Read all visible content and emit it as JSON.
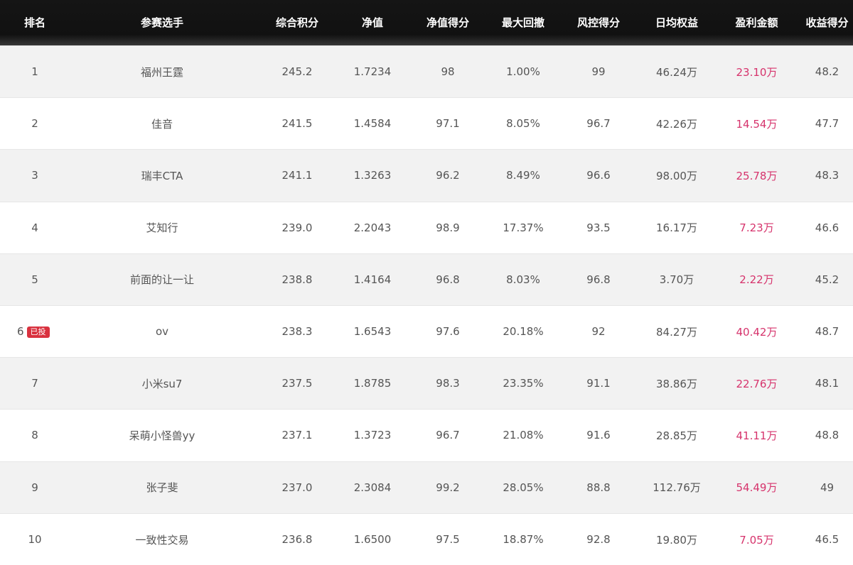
{
  "columns": [
    "排名",
    "参赛选手",
    "综合积分",
    "净值",
    "净值得分",
    "最大回撤",
    "风控得分",
    "日均权益",
    "盈利金额",
    "收益得分"
  ],
  "rows": [
    {
      "rank": "1",
      "name": "福州王霆",
      "score": "245.2",
      "nav": "1.7234",
      "nav_score": "98",
      "drawdown": "1.00%",
      "risk_score": "99",
      "equity": "46.24万",
      "profit": "23.10万",
      "return_score": "48.2",
      "badge": ""
    },
    {
      "rank": "2",
      "name": "佳音",
      "score": "241.5",
      "nav": "1.4584",
      "nav_score": "97.1",
      "drawdown": "8.05%",
      "risk_score": "96.7",
      "equity": "42.26万",
      "profit": "14.54万",
      "return_score": "47.7",
      "badge": ""
    },
    {
      "rank": "3",
      "name": "瑞丰CTA",
      "score": "241.1",
      "nav": "1.3263",
      "nav_score": "96.2",
      "drawdown": "8.49%",
      "risk_score": "96.6",
      "equity": "98.00万",
      "profit": "25.78万",
      "return_score": "48.3",
      "badge": ""
    },
    {
      "rank": "4",
      "name": "艾知行",
      "score": "239.0",
      "nav": "2.2043",
      "nav_score": "98.9",
      "drawdown": "17.37%",
      "risk_score": "93.5",
      "equity": "16.17万",
      "profit": "7.23万",
      "return_score": "46.6",
      "badge": ""
    },
    {
      "rank": "5",
      "name": "前面的让一让",
      "score": "238.8",
      "nav": "1.4164",
      "nav_score": "96.8",
      "drawdown": "8.03%",
      "risk_score": "96.8",
      "equity": "3.70万",
      "profit": "2.22万",
      "return_score": "45.2",
      "badge": ""
    },
    {
      "rank": "6",
      "name": "ov",
      "score": "238.3",
      "nav": "1.6543",
      "nav_score": "97.6",
      "drawdown": "20.18%",
      "risk_score": "92",
      "equity": "84.27万",
      "profit": "40.42万",
      "return_score": "48.7",
      "badge": "已投"
    },
    {
      "rank": "7",
      "name": "小米su7",
      "score": "237.5",
      "nav": "1.8785",
      "nav_score": "98.3",
      "drawdown": "23.35%",
      "risk_score": "91.1",
      "equity": "38.86万",
      "profit": "22.76万",
      "return_score": "48.1",
      "badge": ""
    },
    {
      "rank": "8",
      "name": "呆萌小怪兽yy",
      "score": "237.1",
      "nav": "1.3723",
      "nav_score": "96.7",
      "drawdown": "21.08%",
      "risk_score": "91.6",
      "equity": "28.85万",
      "profit": "41.11万",
      "return_score": "48.8",
      "badge": ""
    },
    {
      "rank": "9",
      "name": "张子斐",
      "score": "237.0",
      "nav": "2.3084",
      "nav_score": "99.2",
      "drawdown": "28.05%",
      "risk_score": "88.8",
      "equity": "112.76万",
      "profit": "54.49万",
      "return_score": "49",
      "badge": ""
    },
    {
      "rank": "10",
      "name": "一致性交易",
      "score": "236.8",
      "nav": "1.6500",
      "nav_score": "97.5",
      "drawdown": "18.87%",
      "risk_score": "92.8",
      "equity": "19.80万",
      "profit": "7.05万",
      "return_score": "46.5",
      "badge": ""
    }
  ],
  "colors": {
    "header_bg": "#111111",
    "profit_text": "#d6336c",
    "badge_bg": "#d9323f",
    "stripe": "#f2f2f2"
  }
}
